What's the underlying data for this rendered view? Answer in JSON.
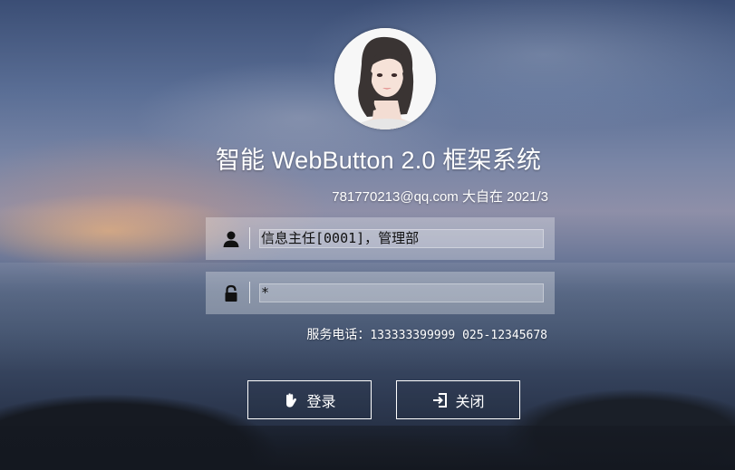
{
  "login": {
    "title": "智能 WebButton 2.0 框架系统",
    "subline": "781770213@qq.com 大自在 2021/3",
    "avatar_icon": "woman-portrait-avatar",
    "user_field": {
      "icon": "user-icon",
      "value": "信息主任[0001]，管理部"
    },
    "password_field": {
      "icon": "lock-icon",
      "value": "*"
    },
    "service_label": "服务电话：",
    "service_numbers": "133333399999 025-12345678",
    "login_button": {
      "icon": "hand-icon",
      "label": "登录"
    },
    "close_button": {
      "icon": "exit-icon",
      "label": "关闭"
    }
  }
}
